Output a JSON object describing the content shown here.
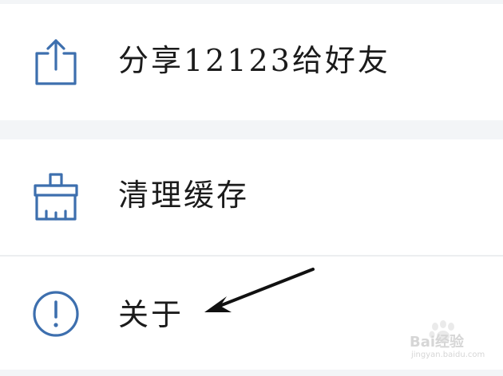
{
  "menu": {
    "items": [
      {
        "label": "分享12123给好友",
        "icon": "share-icon"
      },
      {
        "label": "清理缓存",
        "icon": "broom-icon"
      },
      {
        "label": "关于",
        "icon": "info-exclamation-icon"
      }
    ]
  },
  "annotation": {
    "icon": "arrow-pointer-icon",
    "color": "#111111"
  },
  "watermark": {
    "text": "Bai经验",
    "subtext": "jingyan.baidu.com"
  },
  "colors": {
    "icon_blue": "#3d6fae",
    "text": "#1b1b1b",
    "separator": "#f3f5f7"
  }
}
